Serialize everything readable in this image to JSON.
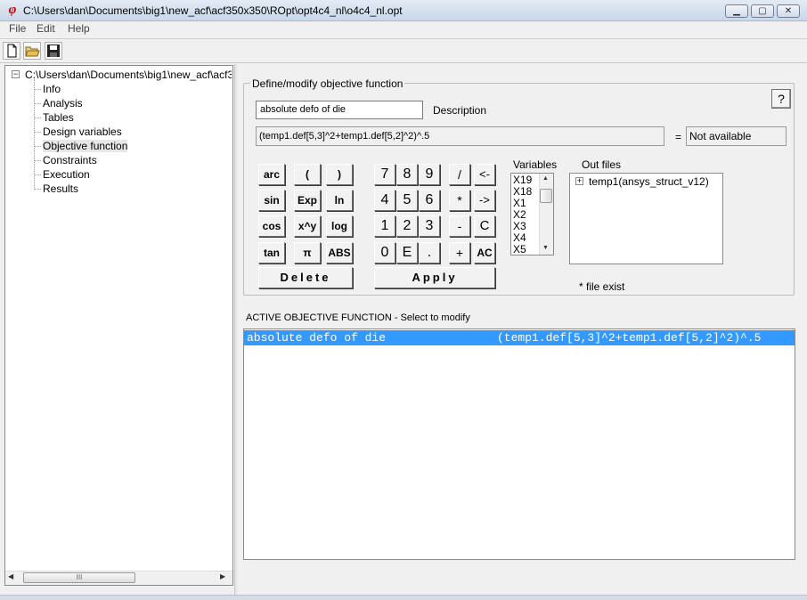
{
  "window": {
    "title": "C:\\Users\\dan\\Documents\\big1\\new_acf\\acf350x350\\ROpt\\opt4c4_nl\\o4c4_nl.opt",
    "app_icon_glyph": "φ",
    "min_glyph": "▁",
    "max_glyph": "▢",
    "close_glyph": "✕"
  },
  "menu": {
    "file": "File",
    "edit": "Edit",
    "help": "Help"
  },
  "tree": {
    "root": "C:\\Users\\dan\\Documents\\big1\\new_acf\\acf350",
    "items": [
      "Info",
      "Analysis",
      "Tables",
      "Design variables",
      "Objective function",
      "Constraints",
      "Execution",
      "Results"
    ],
    "selected": "Objective function",
    "scroll_thumb": "III"
  },
  "form": {
    "group_label": "Define/modify objective function",
    "help_label": "?",
    "description_value": "absolute defo of die",
    "description_label": "Description",
    "expression": "(temp1.def[5,3]^2+temp1.def[5,2]^2)^.5",
    "equals": "=",
    "result": "Not available",
    "delete_label": "Delete",
    "apply_label": "Apply",
    "file_note": "*  file exist"
  },
  "calc": {
    "funcs": [
      "arc",
      "(",
      ")",
      "sin",
      "Exp",
      "ln",
      "cos",
      "x^y",
      "log",
      "tan",
      "π",
      "ABS"
    ],
    "digits": [
      "7",
      "8",
      "9",
      "4",
      "5",
      "6",
      "1",
      "2",
      "3",
      "0",
      "E",
      "."
    ],
    "ops": [
      "/",
      "<-",
      "*",
      "->",
      "-",
      "C",
      "+",
      "AC"
    ]
  },
  "variables": {
    "label": "Variables",
    "items": [
      "X19",
      "X18",
      "X1",
      "X2",
      "X3",
      "X4",
      "X5"
    ]
  },
  "outfiles": {
    "label": "Out files",
    "item": "temp1(ansys_struct_v12)"
  },
  "active": {
    "label": "ACTIVE OBJECTIVE FUNCTION - Select to modify",
    "name": "absolute defo of die",
    "expr": "(temp1.def[5,3]^2+temp1.def[5,2]^2)^.5",
    "highlight_color": "#3399ff"
  }
}
